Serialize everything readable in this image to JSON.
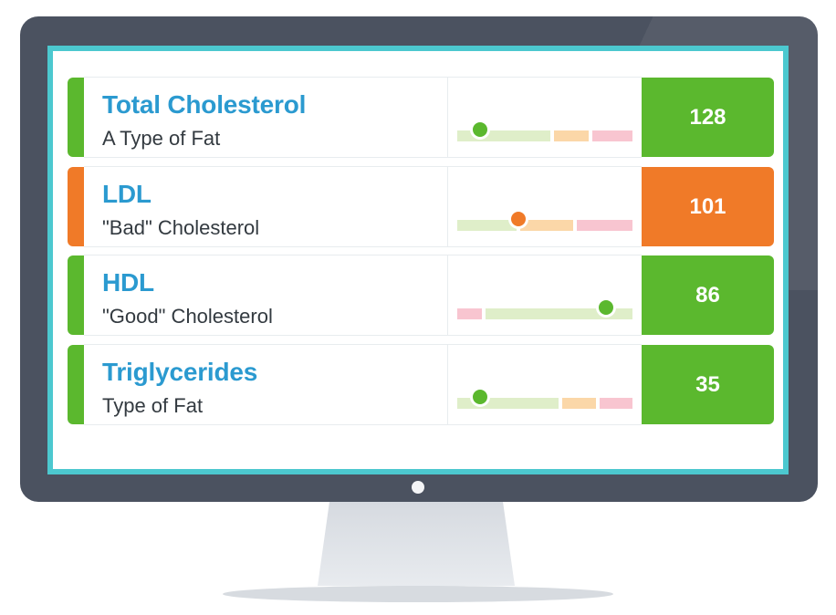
{
  "colors": {
    "good": "#5bb82e",
    "bad": "#f07a28",
    "title": "#2b9ad0",
    "gauge_green": "#dfeec9",
    "gauge_orange": "#fbd7a8",
    "gauge_pink": "#f8c5d0"
  },
  "rows": [
    {
      "title": "Total Cholesterol",
      "subtitle": "A Type of Fat",
      "value": "128",
      "status": "good",
      "gauge": {
        "segments": [
          "green",
          "orange",
          "pink"
        ],
        "splits": [
          0.54,
          0.76
        ],
        "marker": 0.13
      }
    },
    {
      "title": "LDL",
      "subtitle": "\"Bad\" Cholesterol",
      "value": "101",
      "status": "bad",
      "gauge": {
        "segments": [
          "green",
          "orange",
          "pink"
        ],
        "splits": [
          0.35,
          0.67
        ],
        "marker": 0.35
      }
    },
    {
      "title": "HDL",
      "subtitle": "\"Good\" Cholesterol",
      "value": "86",
      "status": "good",
      "gauge": {
        "segments": [
          "pink",
          "green"
        ],
        "splits": [
          0.15
        ],
        "marker": 0.85
      }
    },
    {
      "title": "Triglycerides",
      "subtitle": "Type of Fat",
      "value": "35",
      "status": "good",
      "gauge": {
        "segments": [
          "green",
          "orange",
          "pink"
        ],
        "splits": [
          0.59,
          0.8
        ],
        "marker": 0.13
      }
    }
  ]
}
